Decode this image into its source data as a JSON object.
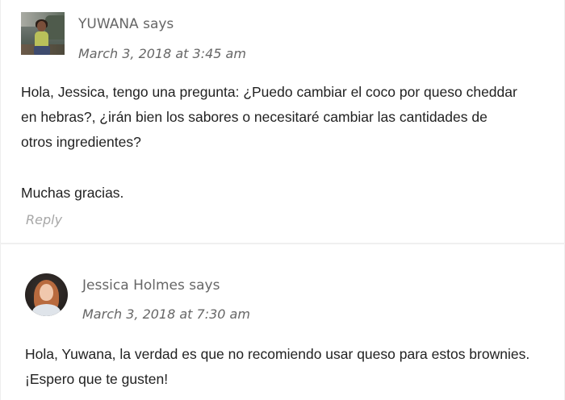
{
  "comments": [
    {
      "author_line": "YUWANA says",
      "date": "March 3, 2018 at 3:45 am",
      "paragraphs": [
        "Hola, Jessica, tengo una pregunta: ¿Puedo cambiar el coco por queso cheddar en hebras?, ¿irán bien los sabores o necesitaré cambiar las cantidades de otros ingredientes?",
        "Muchas gracias."
      ],
      "reply_label": "Reply"
    },
    {
      "author_line": "Jessica Holmes says",
      "date": "March 3, 2018 at 7:30 am",
      "paragraphs": [
        "Hola, Yuwana, la verdad es que no recomiendo usar queso para estos brownies. ¡Espero que te gusten!"
      ]
    }
  ]
}
